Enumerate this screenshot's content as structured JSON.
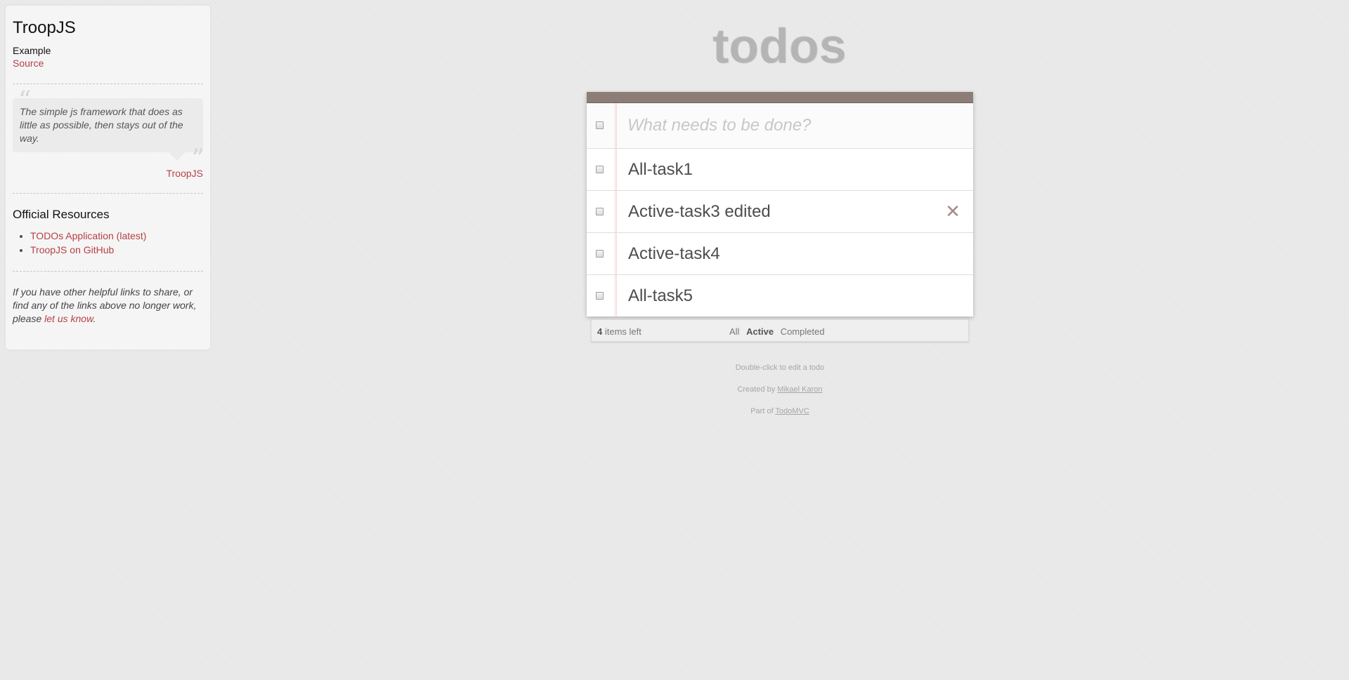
{
  "sidebar": {
    "title": "TroopJS",
    "subtitle": "Example",
    "source_label": "Source",
    "quote": "The simple js framework that does as little as possible, then stays out of the way.",
    "quote_open": "“",
    "quote_close": "”",
    "quote_author": "TroopJS",
    "resources_heading": "Official Resources",
    "resources": [
      "TODOs Application (latest)",
      "TroopJS on GitHub"
    ],
    "footer_text_1": "If you have other helpful links to share, or find any of the links above no longer work, please ",
    "footer_link": "let us know",
    "footer_text_2": "."
  },
  "app": {
    "title": "todos",
    "new_todo_placeholder": "What needs to be done?",
    "todos": [
      {
        "label": "All-task1",
        "completed": false,
        "show_destroy": false
      },
      {
        "label": "Active-task3 edited",
        "completed": false,
        "show_destroy": true
      },
      {
        "label": "Active-task4",
        "completed": false,
        "show_destroy": false
      },
      {
        "label": "All-task5",
        "completed": false,
        "show_destroy": false
      }
    ],
    "destroy_glyph": "✕",
    "footer": {
      "count": "4",
      "count_suffix": " items left",
      "filters": [
        "All",
        "Active",
        "Completed"
      ],
      "selected_filter": "Active"
    },
    "info": {
      "hint": "Double-click to edit a todo",
      "created_by_prefix": "Created by ",
      "created_by_name": "Mikael Karon",
      "part_of_prefix": "Part of ",
      "part_of_name": "TodoMVC"
    }
  },
  "colors": {
    "accent_link": "#b83f45",
    "header_band": "#8d7d77",
    "title_text": "#d0d0d0",
    "background": "#eaeaea"
  }
}
